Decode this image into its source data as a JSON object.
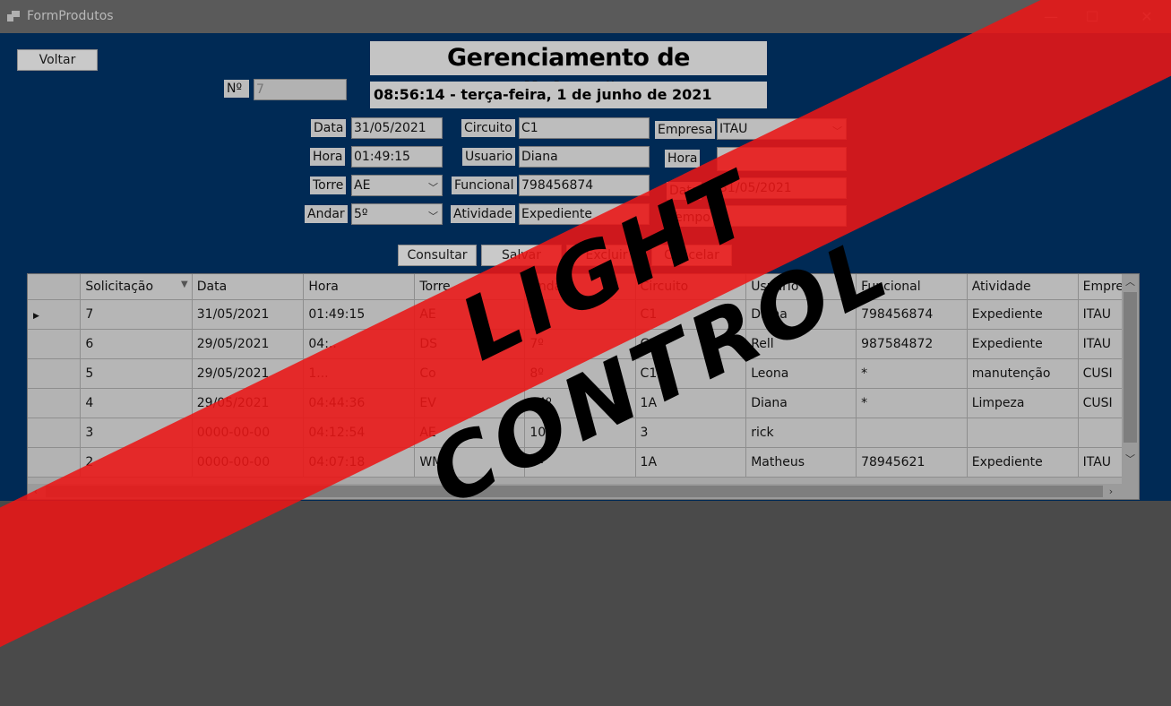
{
  "window": {
    "title": "FormProdutos",
    "minimize": "—",
    "maximize": "☐",
    "close": "✕"
  },
  "form": {
    "back_button": "Voltar",
    "header_title": "Gerenciamento de Solicitações",
    "clock": "08:56:14 - terça-feira, 1 de junho de 2021",
    "numero_label": "Nº",
    "numero_value": "7",
    "data_label": "Data",
    "data_value": "31/05/2021",
    "hora_label": "Hora",
    "hora_value": "01:49:15",
    "torre_label": "Torre",
    "torre_value": "AE",
    "andar_label": "Andar",
    "andar_value": "5º",
    "circuito_label": "Circuito",
    "circuito_value": "C1",
    "usuario_label": "Usuario",
    "usuario_value": "Diana",
    "funcional_label": "Funcional",
    "funcional_value": "798456874",
    "atividade_label": "Atividade",
    "atividade_value": "Expediente",
    "empresa_label": "Empresa",
    "empresa_value": "ITAU",
    "hora2_label": "Hora",
    "hora2_value": "",
    "data2_label": "Data",
    "data2_value": "31/05/2021",
    "tempo_label": "Tempo",
    "tempo_value": "",
    "buttons": {
      "consultar": "Consultar",
      "salvar": "Salvar",
      "excluir": "Excluir",
      "cancelar": "Cancelar"
    }
  },
  "grid": {
    "columns": [
      "Solicitação",
      "Data",
      "Hora",
      "Torre",
      "Andar",
      "Circuito",
      "Usuário",
      "Funcional",
      "Atividade",
      "Empresa"
    ],
    "rows": [
      [
        "7",
        "31/05/2021",
        "01:49:15",
        "AE",
        "5º",
        "C1",
        "Diana",
        "798456874",
        "Expediente",
        "ITAU"
      ],
      [
        "6",
        "29/05/2021",
        "04:..",
        "DS",
        "7º",
        "C2",
        "Rell",
        "987584872",
        "Expediente",
        "ITAU"
      ],
      [
        "5",
        "29/05/2021",
        "1...",
        "Co",
        "8º",
        "C1",
        "Leona",
        "*",
        "manutenção",
        "CUSI"
      ],
      [
        "4",
        "29/05/2021",
        "04:44:36",
        "EV",
        "14º",
        "1A",
        "Diana",
        "*",
        "Limpeza",
        "CUSI"
      ],
      [
        "3",
        "0000-00-00",
        "04:12:54",
        "AE",
        "10º",
        "3",
        "rick",
        "",
        "",
        ""
      ],
      [
        "2",
        "0000-00-00",
        "04:07:18",
        "WMS",
        "9º",
        "1A",
        "Matheus",
        "78945621",
        "Expediente",
        "ITAU"
      ]
    ]
  },
  "overlay": {
    "text": "LIGHT CONTROL",
    "color": "#eb1616"
  }
}
